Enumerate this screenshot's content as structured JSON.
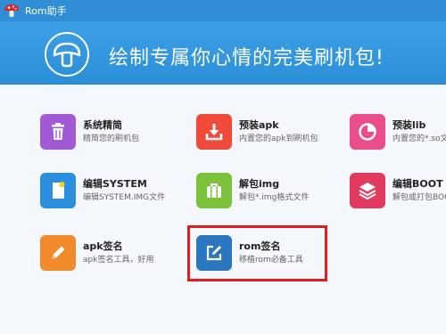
{
  "window": {
    "title": "Rom助手"
  },
  "banner": {
    "slogan": "绘制专属你心情的完美刷机包!"
  },
  "tools": [
    {
      "title": "系统精简",
      "subtitle": "精简您的刷机包",
      "icon": "trash-icon",
      "color": "#a259d6"
    },
    {
      "title": "预装apk",
      "subtitle": "内置您的apk到刷机包",
      "icon": "download-tray-icon",
      "color": "#f04a3a"
    },
    {
      "title": "预装lib",
      "subtitle": "内置您的*.so文",
      "icon": "pie-chart-icon",
      "color": "#e94d8a"
    },
    {
      "title": "编辑SYSTEM",
      "subtitle": "编辑SYSTEM.IMG文件",
      "icon": "file-gear-icon",
      "color": "#2b8fe0"
    },
    {
      "title": "解包img",
      "subtitle": "解包*.img格式文件",
      "icon": "briefcase-icon",
      "color": "#7cc13a"
    },
    {
      "title": "编辑BOOT",
      "subtitle": "解包或打包BOO",
      "icon": "layers-icon",
      "color": "#e23b60"
    },
    {
      "title": "apk签名",
      "subtitle": "apk签名工具，好用",
      "icon": "pencil-icon",
      "color": "#f08a2a"
    },
    {
      "title": "rom签名",
      "subtitle": "移植rom必备工具",
      "icon": "edit-box-icon",
      "color": "#2a76bf"
    }
  ]
}
